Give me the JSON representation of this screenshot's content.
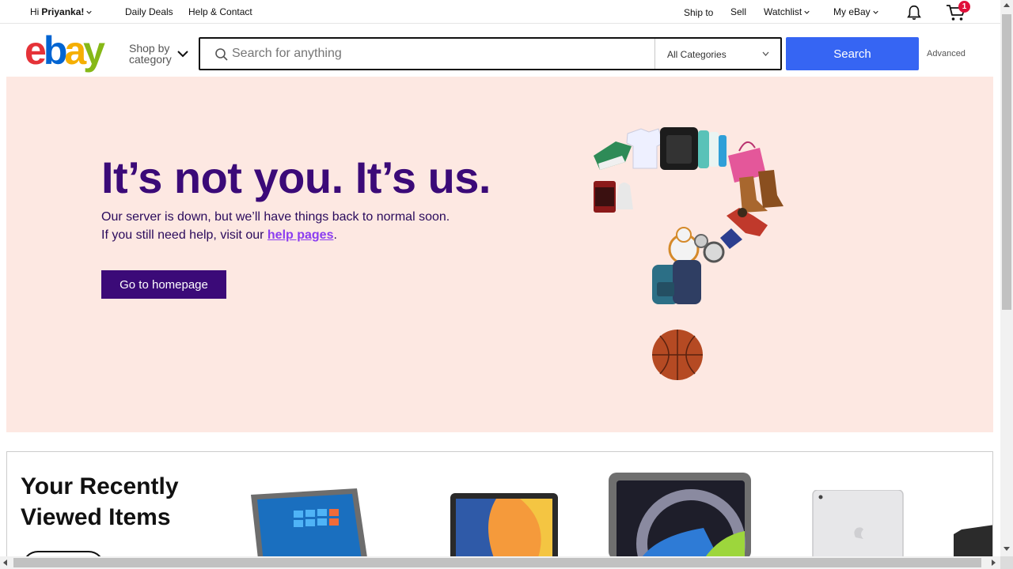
{
  "topbar": {
    "greeting_prefix": "Hi ",
    "greeting_name": "Priyanka!",
    "daily_deals": "Daily Deals",
    "help_contact": "Help & Contact",
    "ship_to": "Ship to",
    "sell": "Sell",
    "watchlist": "Watchlist",
    "my_ebay": "My eBay",
    "cart_count": "1"
  },
  "header": {
    "shop_by_line1": "Shop by",
    "shop_by_line2": "category",
    "search_placeholder": "Search for anything",
    "category_selected": "All Categories",
    "search_button": "Search",
    "advanced": "Advanced"
  },
  "hero": {
    "title": "It’s not you. It’s us.",
    "line1": "Our server is down, but we’ll have things back to normal soon.",
    "line2_prefix": "If you still need help, visit our ",
    "line2_link": "help pages",
    "line2_suffix": ".",
    "button": "Go to homepage"
  },
  "recent": {
    "title_line1": "Your Recently",
    "title_line2": "Viewed Items"
  },
  "colors": {
    "hero_bg": "#fde8e2",
    "hero_text": "#3b0a78",
    "link": "#8b3df0",
    "search_blue": "#3665f3",
    "badge_red": "#e0103a"
  }
}
